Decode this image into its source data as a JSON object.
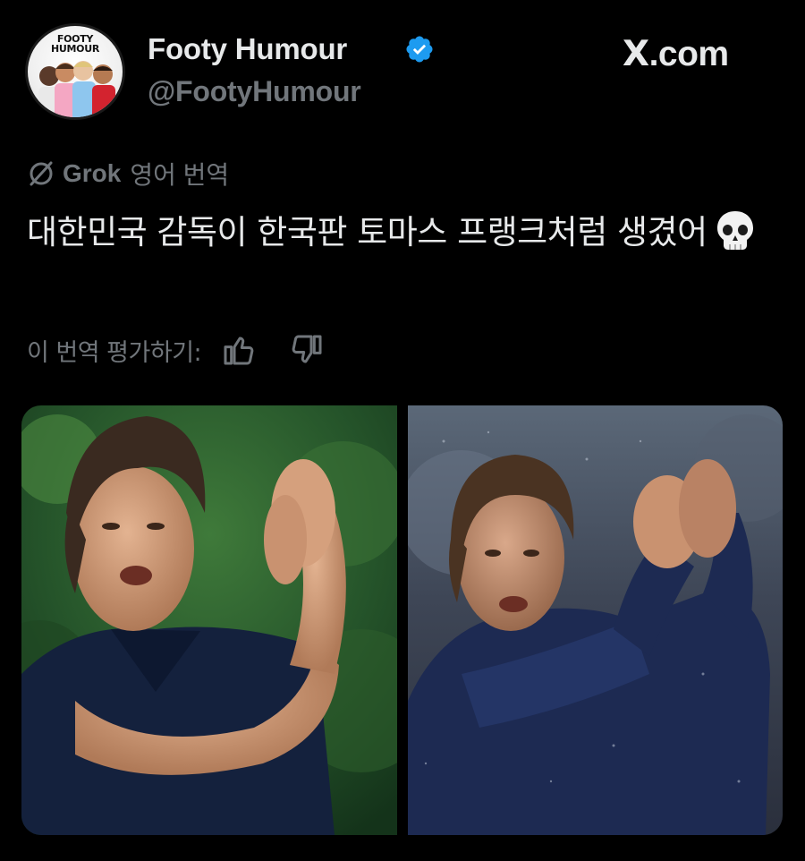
{
  "author": {
    "avatar_wordmark": "FOOTY\nHUMOUR",
    "display_name": "Footy Humour",
    "handle": "@FootyHumour",
    "verified_icon": "verified-badge-icon",
    "verified_color": "#1d9bf0"
  },
  "site": {
    "x_glyph": "𝕏",
    "suffix": ".com"
  },
  "translation": {
    "provider_icon": "grok-icon",
    "provider_label": "Grok",
    "source_language_label": "영어 번역",
    "text": "대한민국 감독이 한국판 토마스 프랭크처럼 생겼어",
    "emoji": "skull-emoji",
    "rate_label": "이 번역 평가하기:",
    "thumbs_up_icon": "thumbs-up-icon",
    "thumbs_down_icon": "thumbs-down-icon"
  },
  "media": {
    "images": [
      {
        "name": "photo-left",
        "description": "photo"
      },
      {
        "name": "photo-right",
        "description": "photo"
      }
    ]
  },
  "colors": {
    "background": "#000000",
    "primary_text": "#e7e9ea",
    "secondary_text": "#71767b",
    "accent": "#1d9bf0"
  }
}
